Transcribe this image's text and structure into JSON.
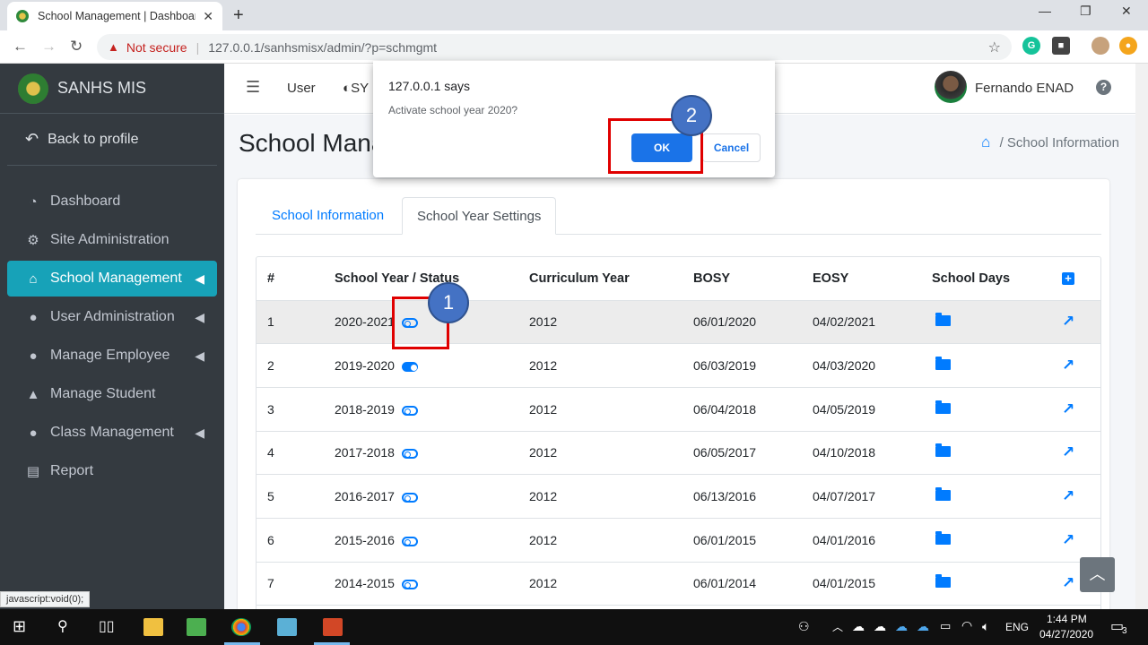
{
  "browser": {
    "tab_title": "School Management | Dashboarc",
    "security_label": "Not secure",
    "url": "127.0.0.1/sanhsmisx/admin/?p=schmgmt",
    "status_url": "javascript:void(0);"
  },
  "sidebar": {
    "brand": "SANHS MIS",
    "back_label": "Back to profile",
    "items": [
      {
        "label": "Dashboard",
        "icon": "tachometer-icon",
        "active": false,
        "chevron": false
      },
      {
        "label": "Site Administration",
        "icon": "cogs-icon",
        "active": false,
        "chevron": false
      },
      {
        "label": "School Management",
        "icon": "school-icon",
        "active": true,
        "chevron": true
      },
      {
        "label": "User Administration",
        "icon": "user-icon",
        "active": false,
        "chevron": true
      },
      {
        "label": "Manage Employee",
        "icon": "user-icon",
        "active": false,
        "chevron": true
      },
      {
        "label": "Manage Student",
        "icon": "graduate-icon",
        "active": false,
        "chevron": false
      },
      {
        "label": "Class Management",
        "icon": "user-icon",
        "active": false,
        "chevron": true
      },
      {
        "label": "Report",
        "icon": "file-icon",
        "active": false,
        "chevron": false
      }
    ]
  },
  "topnav": {
    "user_link": "User",
    "sy_label": "SY",
    "username": "Fernando ENAD"
  },
  "page": {
    "title": "School Mana",
    "breadcrumb_current": "School Information"
  },
  "tabs": {
    "school_information": "School Information",
    "school_year_settings": "School Year Settings"
  },
  "table": {
    "headers": [
      "#",
      "School Year / Status",
      "Curriculum Year",
      "BOSY",
      "EOSY",
      "School Days"
    ],
    "rows": [
      {
        "num": "1",
        "year": "2020-2021",
        "active": false,
        "curriculum": "2012",
        "bosy": "06/01/2020",
        "eosy": "04/02/2021"
      },
      {
        "num": "2",
        "year": "2019-2020",
        "active": true,
        "curriculum": "2012",
        "bosy": "06/03/2019",
        "eosy": "04/03/2020"
      },
      {
        "num": "3",
        "year": "2018-2019",
        "active": false,
        "curriculum": "2012",
        "bosy": "06/04/2018",
        "eosy": "04/05/2019"
      },
      {
        "num": "4",
        "year": "2017-2018",
        "active": false,
        "curriculum": "2012",
        "bosy": "06/05/2017",
        "eosy": "04/10/2018"
      },
      {
        "num": "5",
        "year": "2016-2017",
        "active": false,
        "curriculum": "2012",
        "bosy": "06/13/2016",
        "eosy": "04/07/2017"
      },
      {
        "num": "6",
        "year": "2015-2016",
        "active": false,
        "curriculum": "2012",
        "bosy": "06/01/2015",
        "eosy": "04/01/2016"
      },
      {
        "num": "7",
        "year": "2014-2015",
        "active": false,
        "curriculum": "2012",
        "bosy": "06/01/2014",
        "eosy": "04/01/2015"
      }
    ]
  },
  "dialog": {
    "title": "127.0.0.1 says",
    "message": "Activate school year 2020?",
    "ok_label": "OK",
    "cancel_label": "Cancel"
  },
  "annotations": {
    "step1": "1",
    "step2": "2"
  },
  "taskbar": {
    "language": "ENG",
    "time": "1:44 PM",
    "date": "04/27/2020",
    "notification_count": "3"
  },
  "colors": {
    "sidebar_bg": "#343a40",
    "active_item": "#17a2b8",
    "primary": "#007bff",
    "dialog_ok": "#1a73e8",
    "annotation_red": "#e00000",
    "annotation_bubble": "#4472c4"
  }
}
